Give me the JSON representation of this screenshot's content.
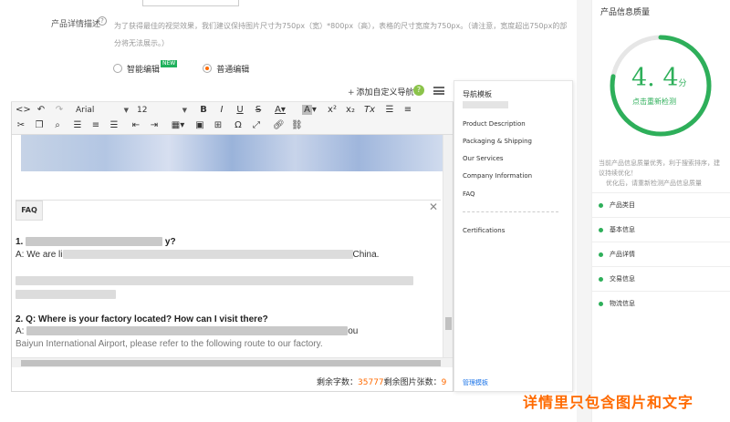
{
  "form": {
    "desc_label": "产品详情描述",
    "desc_text": "为了获得最佳的视觉效果，我们建议保持图片尺寸为750px（宽）*800px（高），表格的尺寸宽度为750px。（请注意，宽度超出750px的部分将无法展示。）",
    "radio_smart": "智能编辑",
    "new_badge": "NEW",
    "radio_normal": "普通编辑"
  },
  "editor": {
    "add_nav": "添加自定义导航",
    "help": "?",
    "font_name": "Arial",
    "font_size": "12",
    "faq_tab": "FAQ",
    "q1_prefix": "1.",
    "q1_suffix": "y?",
    "a1_prefix": "A: We are li",
    "a1_suffix": "China.",
    "para2": "Our factory ...",
    "q2": "2. Q: Where is your factory located? How can I visit there?",
    "a2_prefix": "A: ",
    "a2_tail": "ou",
    "a2_line2": "Baiyun International Airport, please refer to the following route to our factory.",
    "counter_label": "剩余字数：",
    "counter_chars": "35777",
    "counter_images_label": "剩余图片张数：",
    "counter_images": "9"
  },
  "nav_panel": {
    "title": "导航模板",
    "items": [
      "Product Description",
      "Packaging & Shipping",
      "Our Services",
      "Company Information",
      "FAQ"
    ],
    "extra": "Certifications",
    "manage": "管理模板"
  },
  "quality": {
    "title": "产品信息质量",
    "score": "4. 4",
    "unit": "分",
    "recheck": "点击重新检测",
    "hint_line1": "当前产品信息质量优秀，利于搜索排序，建议持续优化！",
    "hint_line2": "优化后，请重新检测产品信息质量",
    "items": [
      "产品类目",
      "基本信息",
      "产品详情",
      "交易信息",
      "物流信息"
    ],
    "ring_fraction": 0.78,
    "accent": "#2eaf5a"
  },
  "watermark": "详情里只包含图片和文字"
}
